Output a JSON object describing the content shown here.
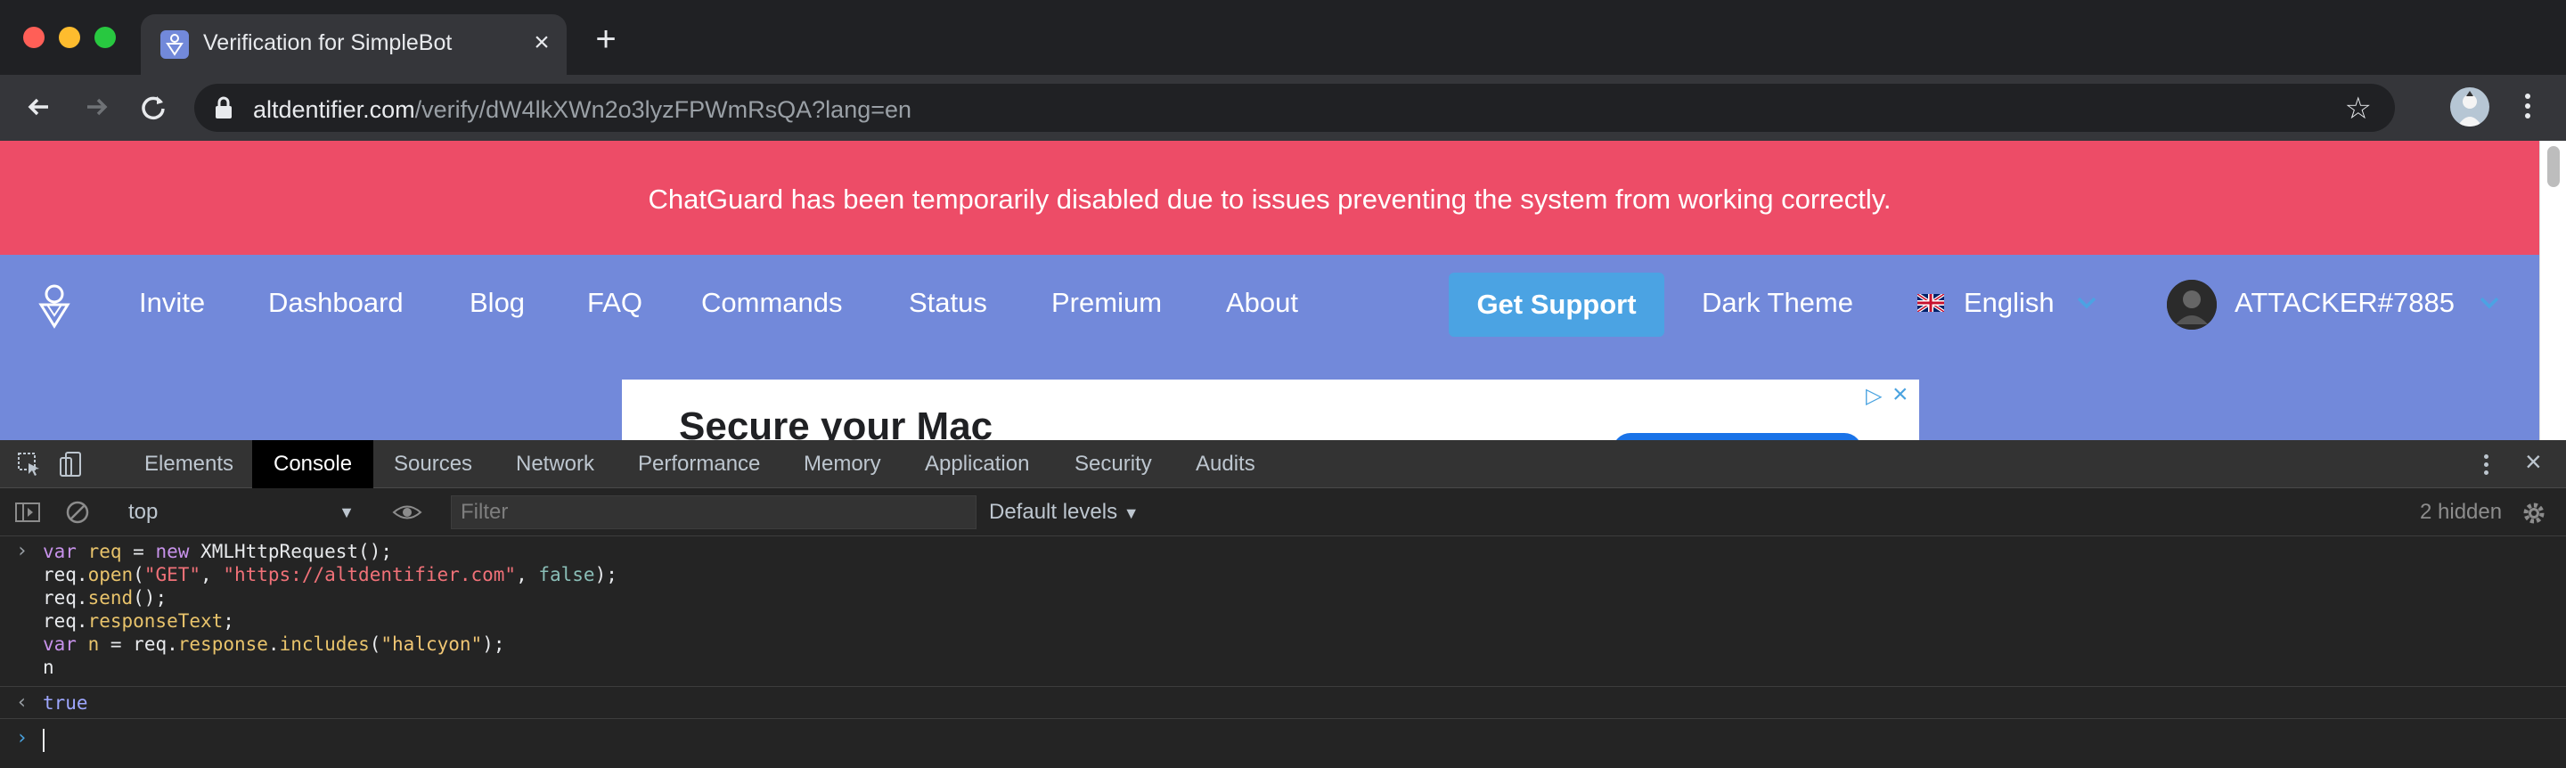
{
  "browser": {
    "tab_title": "Verification for SimpleBot",
    "url_host": "altdentifier.com",
    "url_path": "/verify/dW4lkXWn2o3lyzFPWmRsQA?lang=en"
  },
  "site": {
    "banner": "ChatGuard has been temporarily disabled due to issues preventing the system from working correctly.",
    "nav": [
      "Invite",
      "Dashboard",
      "Blog",
      "FAQ",
      "Commands",
      "Status",
      "Premium",
      "About"
    ],
    "support_button": "Get Support",
    "theme_link": "Dark Theme",
    "language": "English",
    "user": "ATTACKER#7885",
    "ad_headline": "Secure your Mac"
  },
  "devtools": {
    "tabs": [
      "Elements",
      "Console",
      "Sources",
      "Network",
      "Performance",
      "Memory",
      "Application",
      "Security",
      "Audits"
    ],
    "active_tab": "Console",
    "context": "top",
    "filter_placeholder": "Filter",
    "levels": "Default levels",
    "hidden": "2 hidden",
    "console_input": [
      "var req = new XMLHttpRequest();",
      "req.open(\"GET\", \"https://altdentifier.com\", false);",
      "req.send();",
      "req.responseText;",
      "var n = req.response.includes(\"halcyon\");",
      "n"
    ],
    "console_result": "true"
  },
  "colors": {
    "banner": "#ed4c67",
    "page_bg": "#7289da",
    "support_button": "#4ba3e3"
  },
  "icons": [
    "back-icon",
    "forward-icon",
    "reload-icon",
    "lock-icon",
    "star-icon",
    "menu-icon",
    "inspect-icon",
    "device-icon",
    "clear-console-icon",
    "eye-icon",
    "gear-icon"
  ]
}
